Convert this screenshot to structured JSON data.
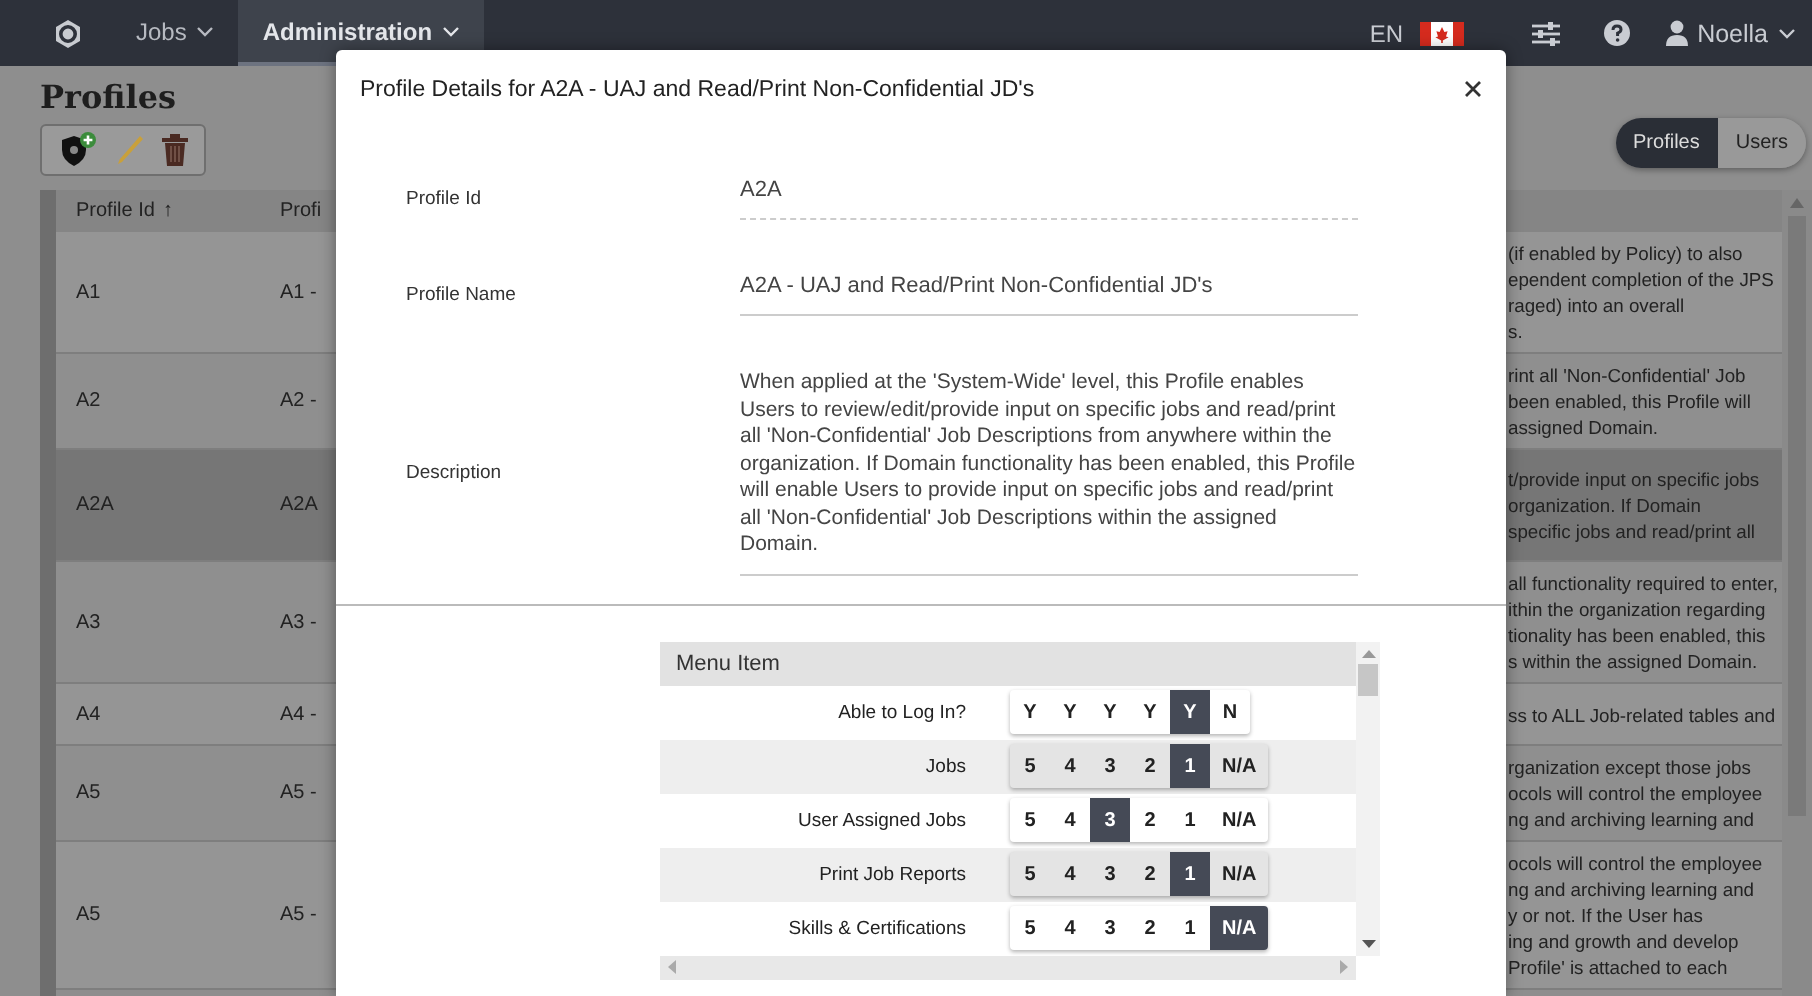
{
  "navbar": {
    "items": [
      {
        "label": "Jobs",
        "selected": false
      },
      {
        "label": "Administration",
        "selected": true
      }
    ],
    "language": "EN",
    "user": "Noella"
  },
  "page": {
    "title": "Profiles",
    "view_toggle": [
      {
        "label": "Profiles",
        "selected": true
      },
      {
        "label": "Users",
        "selected": false
      }
    ],
    "table": {
      "columns": [
        {
          "label": "Profile Id",
          "sort_mark": "↑"
        },
        {
          "label": "Profi"
        }
      ],
      "rows": [
        {
          "id": "A1",
          "name": "A1 -",
          "selected": false,
          "description": [
            "(if enabled by Policy) to also",
            "ependent completion of the JPS",
            "raged) into an overall",
            "s."
          ]
        },
        {
          "id": "A2",
          "name": "A2 -",
          "selected": false,
          "description": [
            "rint all 'Non-Confidential' Job",
            "been enabled, this Profile will",
            "assigned Domain."
          ]
        },
        {
          "id": "A2A",
          "name": "A2A",
          "selected": true,
          "description": [
            "t/provide input on specific jobs",
            "organization. If Domain",
            "specific jobs and read/print all"
          ]
        },
        {
          "id": "A3",
          "name": "A3 -",
          "selected": false,
          "description": [
            "all functionality required to enter,",
            "ithin the organization regarding",
            "tionality has been enabled, this",
            "s within the assigned Domain."
          ]
        },
        {
          "id": "A4",
          "name": "A4 -",
          "selected": false,
          "description": [
            "ss to ALL Job-related tables and"
          ]
        },
        {
          "id": "A5",
          "name": "A5 -",
          "selected": false,
          "description": [
            "rganization except those jobs",
            "ocols will control the employee",
            "ng and archiving learning and"
          ]
        },
        {
          "id": "A5",
          "name": "A5 -",
          "selected": false,
          "description": [
            "ocols will control the employee",
            "ng and archiving learning and",
            "y or not. If the User has",
            "ing and growth and develop",
            "Profile' is attached to each"
          ]
        }
      ]
    }
  },
  "modal": {
    "title": "Profile Details for A2A - UAJ and Read/Print Non-Confidential JD's",
    "fields": [
      {
        "label": "Profile Id",
        "value": "A2A"
      },
      {
        "label": "Profile Name",
        "value": "A2A - UAJ and Read/Print Non-Confidential JD's"
      },
      {
        "label": "Description",
        "value": "When applied at the 'System-Wide' level, this Profile enables Users to review/edit/provide input on specific jobs and read/print all 'Non-Confidential' Job Descriptions from anywhere within the organization.  If Domain functionality has been enabled, this Profile will enable Users to provide input on specific jobs and read/print all 'Non-Confidential' Job Descriptions within the assigned Domain."
      }
    ],
    "matrix": {
      "header": "Menu Item",
      "rows": [
        {
          "label": "Able to Log In?",
          "options": [
            {
              "label": "Y",
              "selected": false
            },
            {
              "label": "Y",
              "selected": false
            },
            {
              "label": "Y",
              "selected": false
            },
            {
              "label": "Y",
              "selected": false
            },
            {
              "label": "Y",
              "selected": true
            },
            {
              "label": "N",
              "selected": false
            }
          ]
        },
        {
          "label": "Jobs",
          "options": [
            {
              "label": "5",
              "selected": false
            },
            {
              "label": "4",
              "selected": false
            },
            {
              "label": "3",
              "selected": false
            },
            {
              "label": "2",
              "selected": false
            },
            {
              "label": "1",
              "selected": true
            },
            {
              "label": "N/A",
              "selected": false
            }
          ]
        },
        {
          "label": "User Assigned Jobs",
          "options": [
            {
              "label": "5",
              "selected": false
            },
            {
              "label": "4",
              "selected": false
            },
            {
              "label": "3",
              "selected": true
            },
            {
              "label": "2",
              "selected": false
            },
            {
              "label": "1",
              "selected": false
            },
            {
              "label": "N/A",
              "selected": false
            }
          ]
        },
        {
          "label": "Print Job Reports",
          "options": [
            {
              "label": "5",
              "selected": false
            },
            {
              "label": "4",
              "selected": false
            },
            {
              "label": "3",
              "selected": false
            },
            {
              "label": "2",
              "selected": false
            },
            {
              "label": "1",
              "selected": true
            },
            {
              "label": "N/A",
              "selected": false
            }
          ]
        },
        {
          "label": "Skills & Certifications",
          "options": [
            {
              "label": "5",
              "selected": false
            },
            {
              "label": "4",
              "selected": false
            },
            {
              "label": "3",
              "selected": false
            },
            {
              "label": "2",
              "selected": false
            },
            {
              "label": "1",
              "selected": false
            },
            {
              "label": "N/A",
              "selected": true
            }
          ]
        }
      ]
    }
  }
}
